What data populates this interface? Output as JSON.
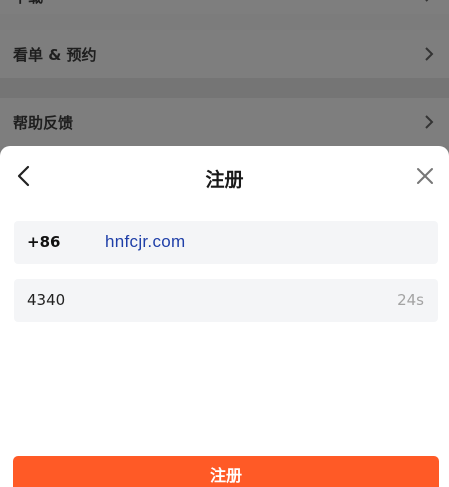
{
  "background_list": {
    "items": [
      {
        "label": "下载",
        "icon": "chevron-right-icon"
      },
      {
        "label": "看单 & 预约",
        "icon": "chevron-right-icon"
      },
      {
        "label": "帮助反馈",
        "icon": "chevron-right-icon"
      }
    ]
  },
  "sheet": {
    "title": "注册",
    "back_icon": "chevron-left-icon",
    "close_icon": "close-icon",
    "phone_field": {
      "country_code": "+86",
      "value": "hnfcjr.com"
    },
    "code_field": {
      "value": "4340",
      "countdown": "24s"
    },
    "submit_label": "注册"
  },
  "colors": {
    "overlay": "#7c7c7c",
    "accent": "#ff5a26",
    "field_bg": "#f4f5f7",
    "watermark_text": "#1f3fa8"
  }
}
